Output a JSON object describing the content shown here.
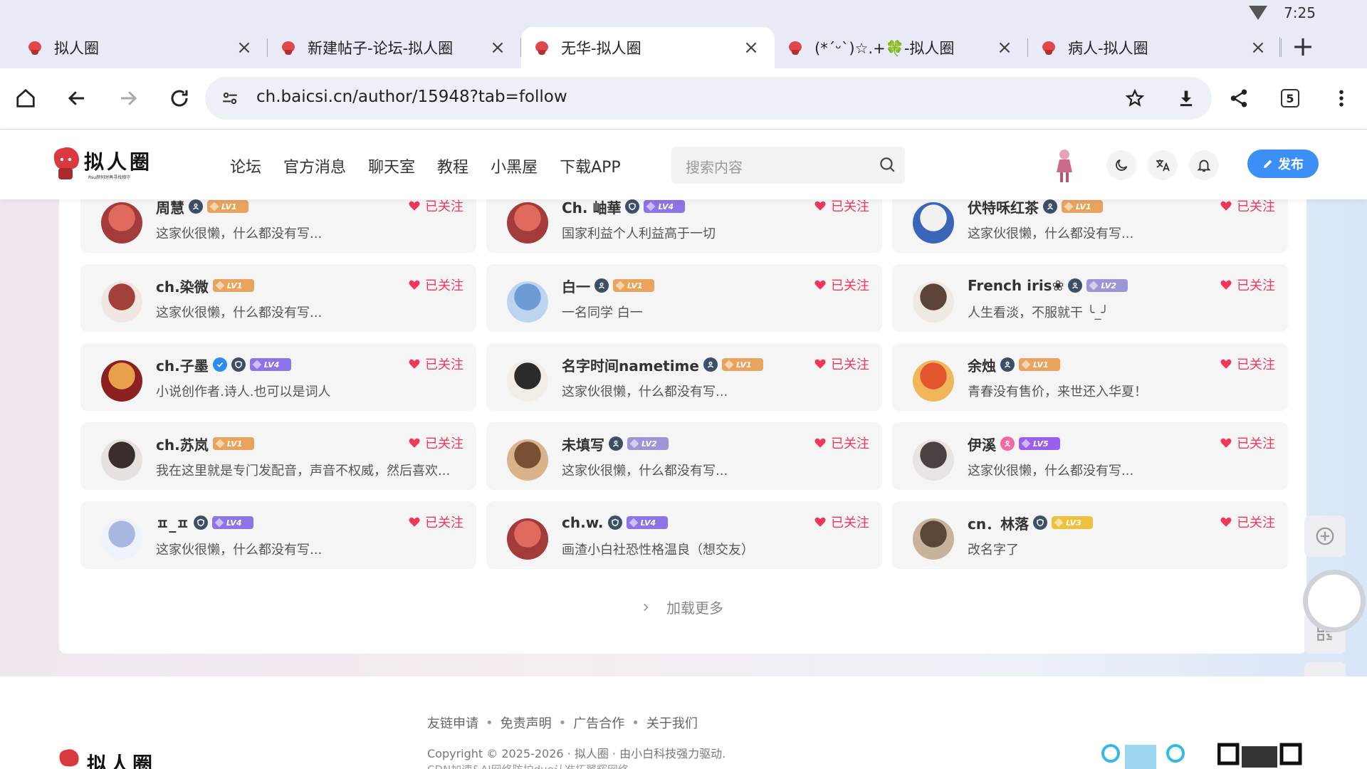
{
  "status": {
    "time": "7:25"
  },
  "tabs": [
    {
      "title": "拟人圈",
      "active": false
    },
    {
      "title": "新建帖子-论坛-拟人圈",
      "active": false
    },
    {
      "title": "无华-拟人圈",
      "active": true
    },
    {
      "title": "(*ˊᵕˋ)☆.+🍀-拟人圈",
      "active": false
    },
    {
      "title": "病人-拟人圈",
      "active": false
    }
  ],
  "toolbar": {
    "url": "ch.baicsi.cn/author/15948?tab=follow",
    "tab_count": "5"
  },
  "site": {
    "logo_text": "拟人圈",
    "logo_sub": "Rsu颜何时再寻找相守",
    "nav": [
      "论坛",
      "官方消息",
      "聊天室",
      "教程",
      "小黑屋",
      "下载APP"
    ],
    "search_placeholder": "搜索内容",
    "publish_label": "发布"
  },
  "follow_label": "已关注",
  "users": [
    {
      "name": "周慧",
      "level": "LV1",
      "level_color": "#e9a35c",
      "badges": [
        "user"
      ],
      "bio": "这家伙很懒，什么都没有写...",
      "avatar_bg": "#a33b3b",
      "avatar_fg": "#e06a5d"
    },
    {
      "name": "Ch. 岫華",
      "level": "LV4",
      "level_color": "#8c73e8",
      "badges": [
        "shield"
      ],
      "bio": "国家利益个人利益高于一切",
      "avatar_bg": "#a33b3b",
      "avatar_fg": "#e06a5d"
    },
    {
      "name": "伏特咊红茶",
      "level": "LV1",
      "level_color": "#e9a35c",
      "badges": [
        "user"
      ],
      "bio": "这家伙很懒，什么都没有写...",
      "avatar_bg": "#3a66b8",
      "avatar_fg": "#f1f1f1"
    },
    {
      "name": "ch.染微",
      "level": "LV1",
      "level_color": "#e9a35c",
      "badges": [],
      "bio": "这家伙很懒，什么都没有写...",
      "avatar_bg": "#f0e7e2",
      "avatar_fg": "#a3403a"
    },
    {
      "name": "白一",
      "level": "LV1",
      "level_color": "#e9a35c",
      "badges": [
        "user"
      ],
      "bio": "一名同学 白一",
      "avatar_bg": "#bcd4ee",
      "avatar_fg": "#6d9bd3"
    },
    {
      "name": "French iris❀",
      "level": "LV2",
      "level_color": "#9c95d6",
      "badges": [
        "user"
      ],
      "bio": "人生看淡，不服就干 ╰_╯",
      "avatar_bg": "#efe9e4",
      "avatar_fg": "#5d4438"
    },
    {
      "name": "ch.子墨",
      "level": "LV4",
      "level_color": "#8c73e8",
      "badges": [
        "verified",
        "shield"
      ],
      "bio": "小说创作者.诗人.也可以是词人",
      "avatar_bg": "#8c1f1f",
      "avatar_fg": "#e8a04b"
    },
    {
      "name": "名字时间nametime",
      "level": "LV1",
      "level_color": "#e9a35c",
      "badges": [
        "user"
      ],
      "bio": "这家伙很懒，什么都没有写...",
      "avatar_bg": "#f2ede6",
      "avatar_fg": "#2c2b2b"
    },
    {
      "name": "余烛",
      "level": "LV1",
      "level_color": "#e9a35c",
      "badges": [
        "user"
      ],
      "bio": "青春没有售价，来世还入华夏！",
      "avatar_bg": "#f2b65a",
      "avatar_fg": "#e2562d"
    },
    {
      "name": "ch.苏岚",
      "level": "LV1",
      "level_color": "#e9a35c",
      "badges": [],
      "bio": "我在这里就是专门发配音，声音不权威，然后喜欢...",
      "avatar_bg": "#e6e1de",
      "avatar_fg": "#3a2e2c"
    },
    {
      "name": "未填写",
      "level": "LV2",
      "level_color": "#9c95d6",
      "badges": [
        "user"
      ],
      "bio": "这家伙很懒，什么都没有写...",
      "avatar_bg": "#d9b48a",
      "avatar_fg": "#7b4f34"
    },
    {
      "name": "伊溪",
      "level": "LV5",
      "level_color": "#9b5ff0",
      "badges": [
        "pink"
      ],
      "bio": "这家伙很懒，什么都没有写...",
      "avatar_bg": "#e8e4e2",
      "avatar_fg": "#4a4240"
    },
    {
      "name": "ㅍ_ㅍ",
      "level": "LV4",
      "level_color": "#8c73e8",
      "badges": [
        "shield"
      ],
      "bio": "这家伙很懒，什么都没有写...",
      "avatar_bg": "#eef2fa",
      "avatar_fg": "#a9b8e2"
    },
    {
      "name": "ch.w.",
      "level": "LV4",
      "level_color": "#8c73e8",
      "badges": [
        "shield"
      ],
      "bio": "画渣小白社恐性格温良（想交友）",
      "avatar_bg": "#a33b3b",
      "avatar_fg": "#e06a5d"
    },
    {
      "name": "cn．林落",
      "level": "LV3",
      "level_color": "#f0c03c",
      "badges": [
        "shield"
      ],
      "bio": "改名字了",
      "avatar_bg": "#c9b29a",
      "avatar_fg": "#5e4636"
    }
  ],
  "load_more": "加载更多",
  "footer": {
    "links": [
      "友链申请",
      "免责声明",
      "广告合作",
      "关于我们"
    ],
    "copyright": "Copyright © 2025-2026 · 拟人圈 · 由小白科技强力驱动.",
    "copyright2": "CDN加速&AI网络防护due认准拓翼辉网络",
    "logo_text": "拟人圈"
  },
  "colors": {
    "accent": "#3b8ff7",
    "follow": "#f2365a"
  }
}
